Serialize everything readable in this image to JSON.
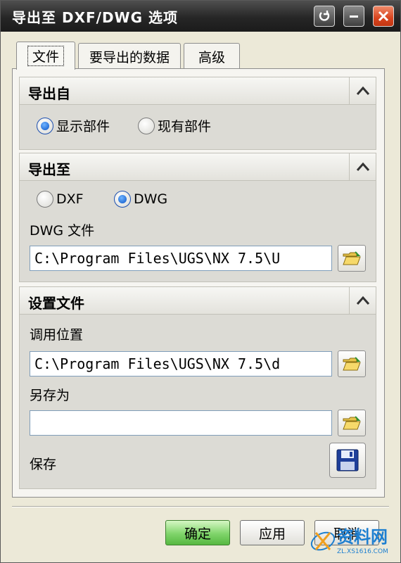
{
  "window": {
    "title": "导出至 DXF/DWG 选项",
    "controls": {
      "help_icon": "reset-icon",
      "minimize_icon": "minimize-icon",
      "close_icon": "close-icon"
    }
  },
  "tabs": [
    {
      "label": "文件",
      "active": true
    },
    {
      "label": "要导出的数据",
      "active": false
    },
    {
      "label": "高级",
      "active": false
    }
  ],
  "export_from": {
    "title": "导出自",
    "options": [
      {
        "label": "显示部件",
        "selected": true
      },
      {
        "label": "现有部件",
        "selected": false
      }
    ]
  },
  "export_to": {
    "title": "导出至",
    "options": [
      {
        "label": "DXF",
        "selected": false
      },
      {
        "label": "DWG",
        "selected": true
      }
    ],
    "file_label": "DWG 文件",
    "file_value": "C:\\Program Files\\UGS\\NX 7.5\\U"
  },
  "settings_file": {
    "title": "设置文件",
    "load_label": "调用位置",
    "load_value": "C:\\Program Files\\UGS\\NX 7.5\\d",
    "save_as_label": "另存为",
    "save_as_value": "",
    "save_label": "保存"
  },
  "buttons": {
    "ok": "确定",
    "apply": "应用",
    "cancel": "取消"
  },
  "watermark": {
    "text": "资料网",
    "url": "ZL.XS1616.COM"
  },
  "colors": {
    "titlebar": "#262626",
    "close_button": "#d8451f",
    "ok_button": "#7fd46a",
    "radio_selected": "#0a54c8"
  }
}
